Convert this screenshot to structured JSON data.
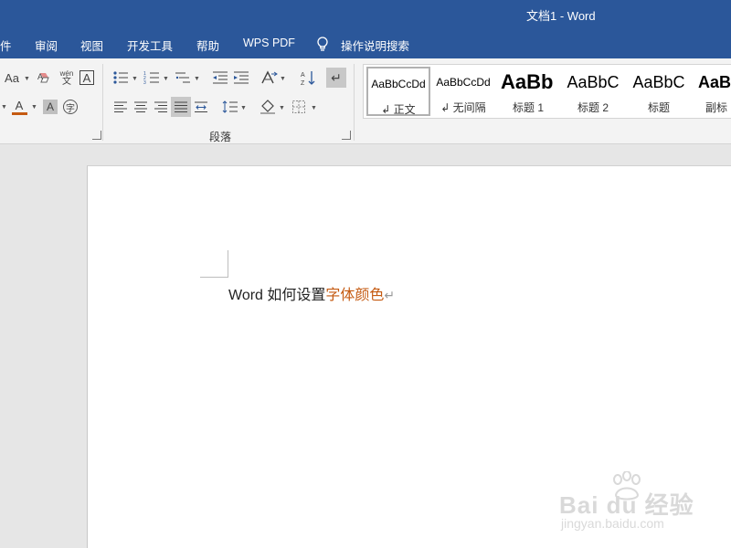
{
  "window": {
    "title": "文档1  -  Word"
  },
  "menu": {
    "tabs": [
      "件",
      "审阅",
      "视图",
      "开发工具",
      "帮助",
      "WPS PDF"
    ],
    "tell_me": "操作说明搜索"
  },
  "ribbon": {
    "font_group": {
      "change_case": "Aa",
      "phonetic_top": "wén",
      "phonetic_bottom": "文",
      "char_border": "A",
      "font_color": "A",
      "char_shading": "A",
      "enclose": "字"
    },
    "paragraph_group": {
      "label": "段落"
    },
    "styles": [
      {
        "sample": "AaBbCcDd",
        "name": "↲ 正文",
        "selected": true
      },
      {
        "sample": "AaBbCcDd",
        "name": "↲ 无间隔",
        "selected": false
      },
      {
        "sample": "AaBb",
        "name": "标题 1",
        "selected": false
      },
      {
        "sample": "AaBbC",
        "name": "标题 2",
        "selected": false
      },
      {
        "sample": "AaBbC",
        "name": "标题",
        "selected": false
      },
      {
        "sample": "AaBl",
        "name": "副标",
        "selected": false
      }
    ]
  },
  "document": {
    "text_plain": "Word 如何设置",
    "text_colored": "字体颜色",
    "paragraph_mark": "↵"
  },
  "colors": {
    "title_bar": "#2b579a",
    "font_color_underline": "#c55a11",
    "colored_text": "#c55a11"
  },
  "watermark": {
    "main": "Bai du 经验",
    "url": "jingyan.baidu.com"
  }
}
